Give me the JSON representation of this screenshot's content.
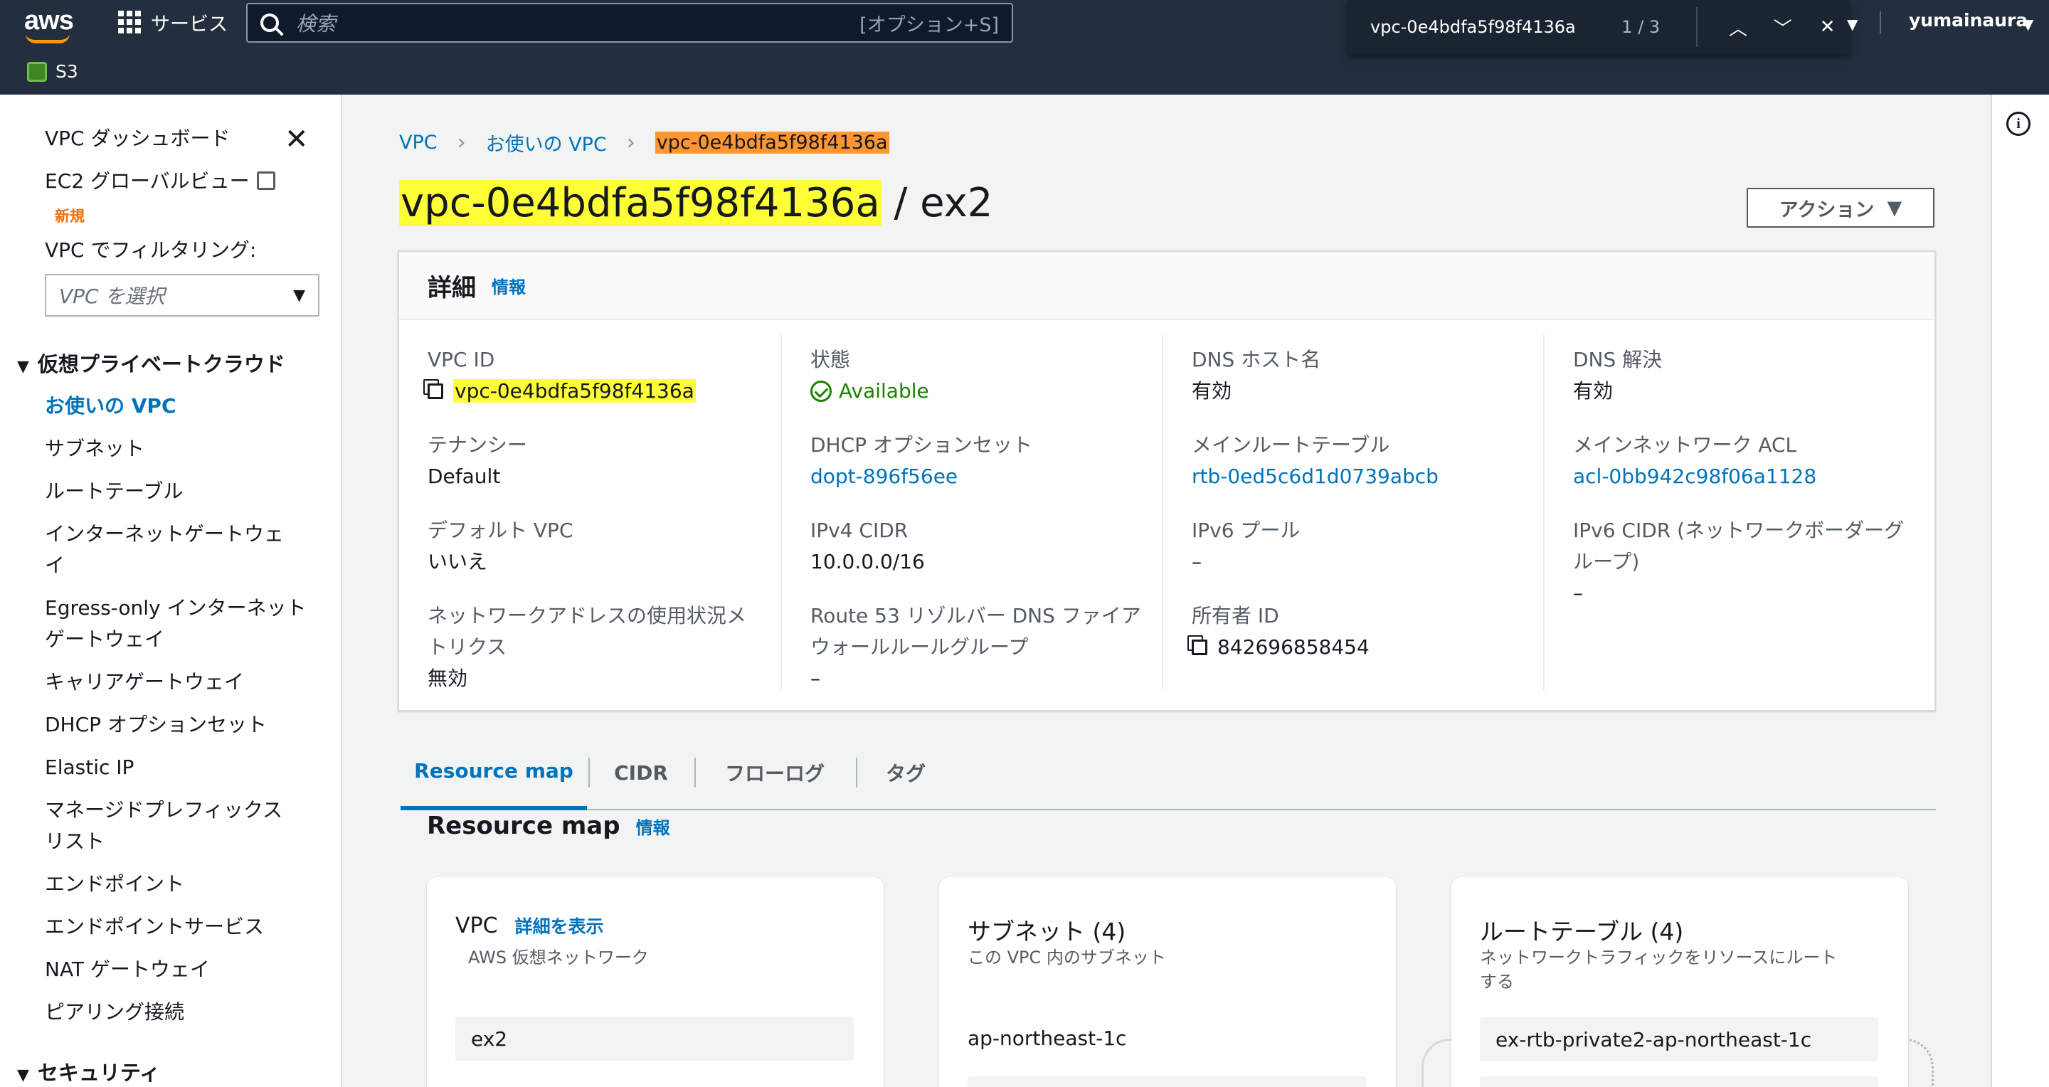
{
  "topnav": {
    "logo": "aws",
    "services_label": "サービス",
    "search_placeholder": "検索",
    "search_shortcut": "[オプション+S]",
    "find_query": "vpc-0e4bdfa5f98f4136a",
    "find_count": "1 / 3",
    "user": "yumainaura",
    "favorite": "S3"
  },
  "sidebar": {
    "dashboard": "VPC ダッシュボード",
    "ec2_global": "EC2 グローバルビュー",
    "new_badge": "新規",
    "filter_label": "VPC でフィルタリング:",
    "filter_placeholder": "VPC を選択",
    "section_vpc": "仮想プライベートクラウド",
    "items": [
      "お使いの VPC",
      "サブネット",
      "ルートテーブル",
      "インターネットゲートウェイ",
      "Egress-only インターネットゲートウェイ",
      "キャリアゲートウェイ",
      "DHCP オプションセット",
      "Elastic IP",
      "マネージドプレフィックスリスト",
      "エンドポイント",
      "エンドポイントサービス",
      "NAT ゲートウェイ",
      "ピアリング接続"
    ],
    "section_security": "セキュリティ"
  },
  "breadcrumb": {
    "vpc": "VPC",
    "your_vpcs": "お使いの VPC",
    "current": "vpc-0e4bdfa5f98f4136a"
  },
  "page": {
    "vpc_id": "vpc-0e4bdfa5f98f4136a",
    "title_suffix": " / ex2",
    "action_label": "アクション"
  },
  "details": {
    "title": "詳細",
    "info": "情報",
    "fields": {
      "vpc_id_label": "VPC ID",
      "vpc_id": "vpc-0e4bdfa5f98f4136a",
      "state_label": "状態",
      "state": "Available",
      "dns_host_label": "DNS ホスト名",
      "dns_host": "有効",
      "dns_res_label": "DNS 解決",
      "dns_res": "有効",
      "tenancy_label": "テナンシー",
      "tenancy": "Default",
      "dhcp_label": "DHCP オプションセット",
      "dhcp": "dopt-896f56ee",
      "main_rt_label": "メインルートテーブル",
      "main_rt": "rtb-0ed5c6d1d0739abcb",
      "main_acl_label": "メインネットワーク ACL",
      "main_acl": "acl-0bb942c98f06a1128",
      "default_vpc_label": "デフォルト VPC",
      "default_vpc": "いいえ",
      "ipv4_label": "IPv4 CIDR",
      "ipv4": "10.0.0.0/16",
      "ipv6_pool_label": "IPv6 プール",
      "ipv6_pool": "–",
      "ipv6_cidr_label": "IPv6 CIDR (ネットワークボーダーグループ)",
      "ipv6_cidr": "–",
      "net_usage_label": "ネットワークアドレスの使用状況メトリクス",
      "net_usage": "無効",
      "route53_label": "Route 53 リゾルバー DNS ファイアウォールルールグループ",
      "route53": "–",
      "owner_label": "所有者 ID",
      "owner": "842696858454"
    }
  },
  "tabs": [
    "Resource map",
    "CIDR",
    "フローログ",
    "タグ"
  ],
  "resource_map": {
    "title": "Resource map",
    "info": "情報",
    "vpc_card": {
      "title": "VPC",
      "link": "詳細を表示",
      "sub": "AWS 仮想ネットワーク",
      "item": "ex2"
    },
    "subnet_card": {
      "title": "サブネット (4)",
      "sub": "この VPC 内のサブネット",
      "group": "ap-northeast-1c"
    },
    "rt_card": {
      "title": "ルートテーブル (4)",
      "sub": "ネットワークトラフィックをリソースにルートする",
      "item": "ex-rtb-private2-ap-northeast-1c"
    }
  }
}
